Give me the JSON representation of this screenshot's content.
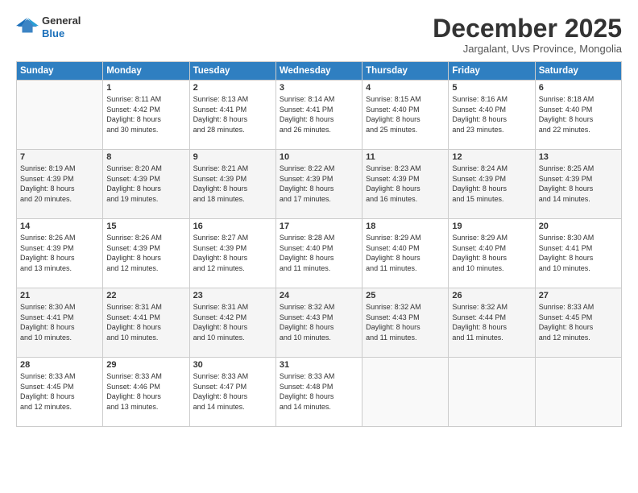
{
  "logo": {
    "general": "General",
    "blue": "Blue"
  },
  "header": {
    "month": "December 2025",
    "location": "Jargalant, Uvs Province, Mongolia"
  },
  "days_of_week": [
    "Sunday",
    "Monday",
    "Tuesday",
    "Wednesday",
    "Thursday",
    "Friday",
    "Saturday"
  ],
  "weeks": [
    [
      {
        "day": "",
        "info": ""
      },
      {
        "day": "1",
        "info": "Sunrise: 8:11 AM\nSunset: 4:42 PM\nDaylight: 8 hours\nand 30 minutes."
      },
      {
        "day": "2",
        "info": "Sunrise: 8:13 AM\nSunset: 4:41 PM\nDaylight: 8 hours\nand 28 minutes."
      },
      {
        "day": "3",
        "info": "Sunrise: 8:14 AM\nSunset: 4:41 PM\nDaylight: 8 hours\nand 26 minutes."
      },
      {
        "day": "4",
        "info": "Sunrise: 8:15 AM\nSunset: 4:40 PM\nDaylight: 8 hours\nand 25 minutes."
      },
      {
        "day": "5",
        "info": "Sunrise: 8:16 AM\nSunset: 4:40 PM\nDaylight: 8 hours\nand 23 minutes."
      },
      {
        "day": "6",
        "info": "Sunrise: 8:18 AM\nSunset: 4:40 PM\nDaylight: 8 hours\nand 22 minutes."
      }
    ],
    [
      {
        "day": "7",
        "info": "Sunrise: 8:19 AM\nSunset: 4:39 PM\nDaylight: 8 hours\nand 20 minutes."
      },
      {
        "day": "8",
        "info": "Sunrise: 8:20 AM\nSunset: 4:39 PM\nDaylight: 8 hours\nand 19 minutes."
      },
      {
        "day": "9",
        "info": "Sunrise: 8:21 AM\nSunset: 4:39 PM\nDaylight: 8 hours\nand 18 minutes."
      },
      {
        "day": "10",
        "info": "Sunrise: 8:22 AM\nSunset: 4:39 PM\nDaylight: 8 hours\nand 17 minutes."
      },
      {
        "day": "11",
        "info": "Sunrise: 8:23 AM\nSunset: 4:39 PM\nDaylight: 8 hours\nand 16 minutes."
      },
      {
        "day": "12",
        "info": "Sunrise: 8:24 AM\nSunset: 4:39 PM\nDaylight: 8 hours\nand 15 minutes."
      },
      {
        "day": "13",
        "info": "Sunrise: 8:25 AM\nSunset: 4:39 PM\nDaylight: 8 hours\nand 14 minutes."
      }
    ],
    [
      {
        "day": "14",
        "info": "Sunrise: 8:26 AM\nSunset: 4:39 PM\nDaylight: 8 hours\nand 13 minutes."
      },
      {
        "day": "15",
        "info": "Sunrise: 8:26 AM\nSunset: 4:39 PM\nDaylight: 8 hours\nand 12 minutes."
      },
      {
        "day": "16",
        "info": "Sunrise: 8:27 AM\nSunset: 4:39 PM\nDaylight: 8 hours\nand 12 minutes."
      },
      {
        "day": "17",
        "info": "Sunrise: 8:28 AM\nSunset: 4:40 PM\nDaylight: 8 hours\nand 11 minutes."
      },
      {
        "day": "18",
        "info": "Sunrise: 8:29 AM\nSunset: 4:40 PM\nDaylight: 8 hours\nand 11 minutes."
      },
      {
        "day": "19",
        "info": "Sunrise: 8:29 AM\nSunset: 4:40 PM\nDaylight: 8 hours\nand 10 minutes."
      },
      {
        "day": "20",
        "info": "Sunrise: 8:30 AM\nSunset: 4:41 PM\nDaylight: 8 hours\nand 10 minutes."
      }
    ],
    [
      {
        "day": "21",
        "info": "Sunrise: 8:30 AM\nSunset: 4:41 PM\nDaylight: 8 hours\nand 10 minutes."
      },
      {
        "day": "22",
        "info": "Sunrise: 8:31 AM\nSunset: 4:41 PM\nDaylight: 8 hours\nand 10 minutes."
      },
      {
        "day": "23",
        "info": "Sunrise: 8:31 AM\nSunset: 4:42 PM\nDaylight: 8 hours\nand 10 minutes."
      },
      {
        "day": "24",
        "info": "Sunrise: 8:32 AM\nSunset: 4:43 PM\nDaylight: 8 hours\nand 10 minutes."
      },
      {
        "day": "25",
        "info": "Sunrise: 8:32 AM\nSunset: 4:43 PM\nDaylight: 8 hours\nand 11 minutes."
      },
      {
        "day": "26",
        "info": "Sunrise: 8:32 AM\nSunset: 4:44 PM\nDaylight: 8 hours\nand 11 minutes."
      },
      {
        "day": "27",
        "info": "Sunrise: 8:33 AM\nSunset: 4:45 PM\nDaylight: 8 hours\nand 12 minutes."
      }
    ],
    [
      {
        "day": "28",
        "info": "Sunrise: 8:33 AM\nSunset: 4:45 PM\nDaylight: 8 hours\nand 12 minutes."
      },
      {
        "day": "29",
        "info": "Sunrise: 8:33 AM\nSunset: 4:46 PM\nDaylight: 8 hours\nand 13 minutes."
      },
      {
        "day": "30",
        "info": "Sunrise: 8:33 AM\nSunset: 4:47 PM\nDaylight: 8 hours\nand 14 minutes."
      },
      {
        "day": "31",
        "info": "Sunrise: 8:33 AM\nSunset: 4:48 PM\nDaylight: 8 hours\nand 14 minutes."
      },
      {
        "day": "",
        "info": ""
      },
      {
        "day": "",
        "info": ""
      },
      {
        "day": "",
        "info": ""
      }
    ]
  ]
}
